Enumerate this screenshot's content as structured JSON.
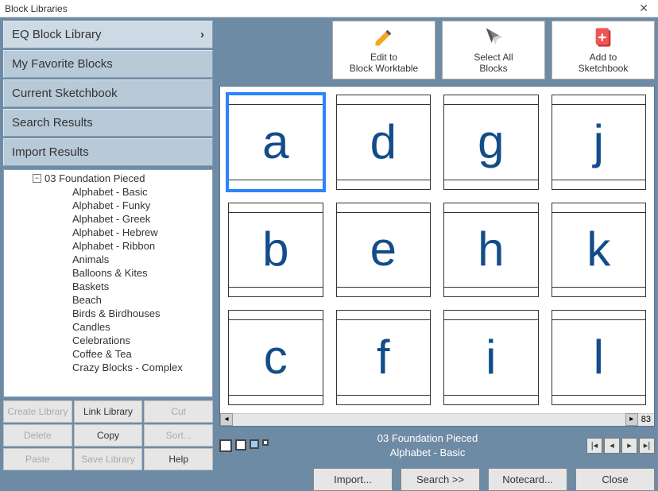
{
  "window": {
    "title": "Block Libraries"
  },
  "nav": {
    "sections": [
      "EQ Block Library",
      "My Favorite Blocks",
      "Current Sketchbook",
      "Search Results",
      "Import Results"
    ]
  },
  "tree": {
    "parent": "03 Foundation Pieced",
    "children": [
      "Alphabet - Basic",
      "Alphabet - Funky",
      "Alphabet - Greek",
      "Alphabet - Hebrew",
      "Alphabet - Ribbon",
      "Animals",
      "Balloons & Kites",
      "Baskets",
      "Beach",
      "Birds & Birdhouses",
      "Candles",
      "Celebrations",
      "Coffee & Tea",
      "Crazy Blocks - Complex"
    ]
  },
  "left_buttons": {
    "create": "Create Library",
    "link": "Link Library",
    "cut": "Cut",
    "delete": "Delete",
    "copy": "Copy",
    "sort": "Sort...",
    "paste": "Paste",
    "save": "Save Library",
    "help": "Help"
  },
  "actions": {
    "edit": {
      "line1": "Edit to",
      "line2": "Block Worktable"
    },
    "select": {
      "line1": "Select All",
      "line2": "Blocks"
    },
    "add": {
      "line1": "Add to",
      "line2": "Sketchbook"
    }
  },
  "grid": {
    "letters": [
      "a",
      "d",
      "g",
      "j",
      "b",
      "e",
      "h",
      "k",
      "c",
      "f",
      "i",
      "l"
    ],
    "selected": 0,
    "count": "83"
  },
  "info": {
    "line1": "03 Foundation Pieced",
    "line2": "Alphabet - Basic"
  },
  "bottom": {
    "import": "Import...",
    "search": "Search    >>",
    "notecard": "Notecard...",
    "close": "Close"
  }
}
